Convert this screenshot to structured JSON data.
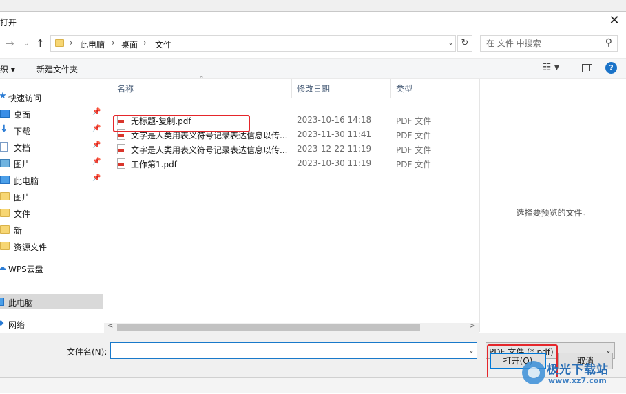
{
  "dialog": {
    "title": "打开"
  },
  "address": {
    "crumbs": [
      "此电脑",
      "桌面",
      "文件"
    ],
    "search_placeholder": "在 文件 中搜索"
  },
  "toolbar": {
    "organize_label": "织 ▾",
    "new_folder_label": "新建文件夹"
  },
  "sidebar": {
    "items": [
      {
        "label": "快速访问",
        "icon": "star-icon"
      },
      {
        "label": "桌面",
        "icon": "desktop-icon",
        "pinned": true
      },
      {
        "label": "下载",
        "icon": "download-icon",
        "pinned": true
      },
      {
        "label": "文档",
        "icon": "document-icon",
        "pinned": true
      },
      {
        "label": "图片",
        "icon": "picture-icon",
        "pinned": true
      },
      {
        "label": "此电脑",
        "icon": "computer-icon",
        "pinned": true
      },
      {
        "label": "图片",
        "icon": "folder-icon"
      },
      {
        "label": "文件",
        "icon": "folder-icon"
      },
      {
        "label": "新",
        "icon": "folder-icon"
      },
      {
        "label": "资源文件",
        "icon": "folder-icon"
      },
      {
        "label": "WPS云盘",
        "icon": "cloud-icon"
      },
      {
        "label": "此电脑",
        "icon": "computer-icon",
        "selected": true
      },
      {
        "label": "网络",
        "icon": "network-icon"
      }
    ]
  },
  "filelist": {
    "columns": {
      "name": "名称",
      "date": "修改日期",
      "type": "类型"
    },
    "rows": [
      {
        "name": "无标题-复制.pdf",
        "date": "2023-10-16 14:18",
        "type": "PDF 文件"
      },
      {
        "name": "文字是人类用表义符号记录表达信息以传...",
        "date": "2023-11-30 11:41",
        "type": "PDF 文件"
      },
      {
        "name": "文字是人类用表义符号记录表达信息以传...",
        "date": "2023-12-22 11:19",
        "type": "PDF 文件"
      },
      {
        "name": "工作第1.pdf",
        "date": "2023-10-30 11:19",
        "type": "PDF 文件"
      }
    ]
  },
  "preview": {
    "text": "选择要预览的文件。"
  },
  "bottom": {
    "filename_label": "文件名(N):",
    "filename_value": "",
    "filetype_value": "PDF 文件 (*.pdf)",
    "open_label": "打开(O)",
    "cancel_label": "取消"
  },
  "watermark": {
    "title": "极光下载站",
    "url": "www.xz7.com"
  },
  "colors": {
    "accent": "#0078d7",
    "annotation": "#e5262b",
    "selected": "#d9d9d9"
  }
}
